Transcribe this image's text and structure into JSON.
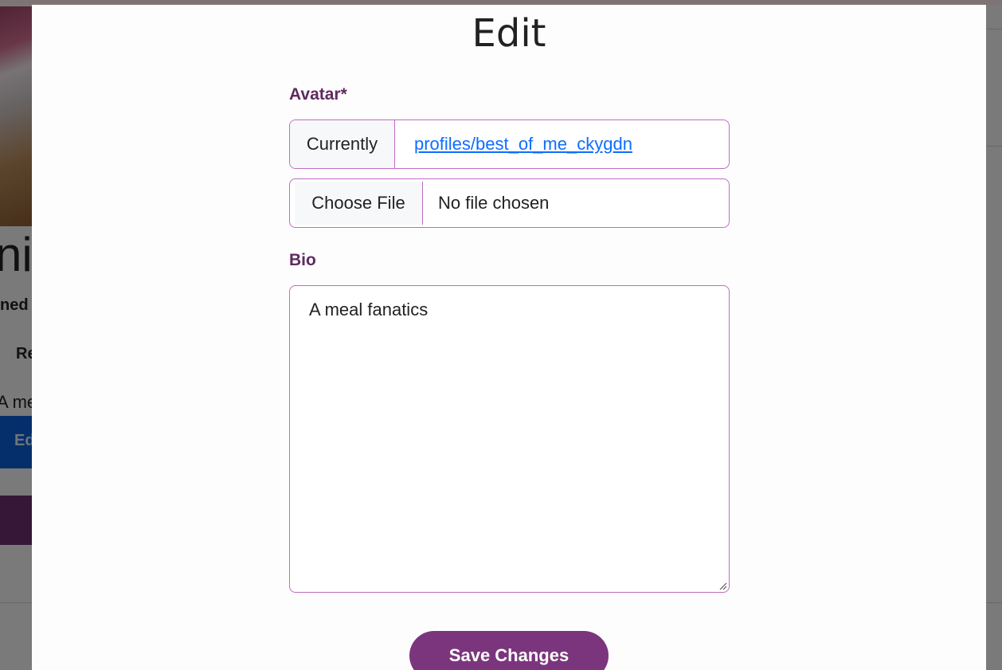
{
  "background": {
    "name_fragment": "ni",
    "joined_fragment": "ned",
    "recipes_fragment": "Re",
    "bio_fragment": "A me",
    "edit_button_fragment": "Ed"
  },
  "modal": {
    "title": "Edit",
    "avatar": {
      "label": "Avatar*",
      "currently_label": "Currently",
      "current_file": "profiles/best_of_me_ckygdn",
      "choose_button": "Choose File",
      "file_status": "No file chosen"
    },
    "bio": {
      "label": "Bio",
      "value": "A meal fanatics"
    },
    "save_button": "Save Changes"
  },
  "colors": {
    "accent": "#7b357d",
    "label": "#5f2a5f",
    "border": "#c06cc0",
    "link": "#0d6efd"
  }
}
